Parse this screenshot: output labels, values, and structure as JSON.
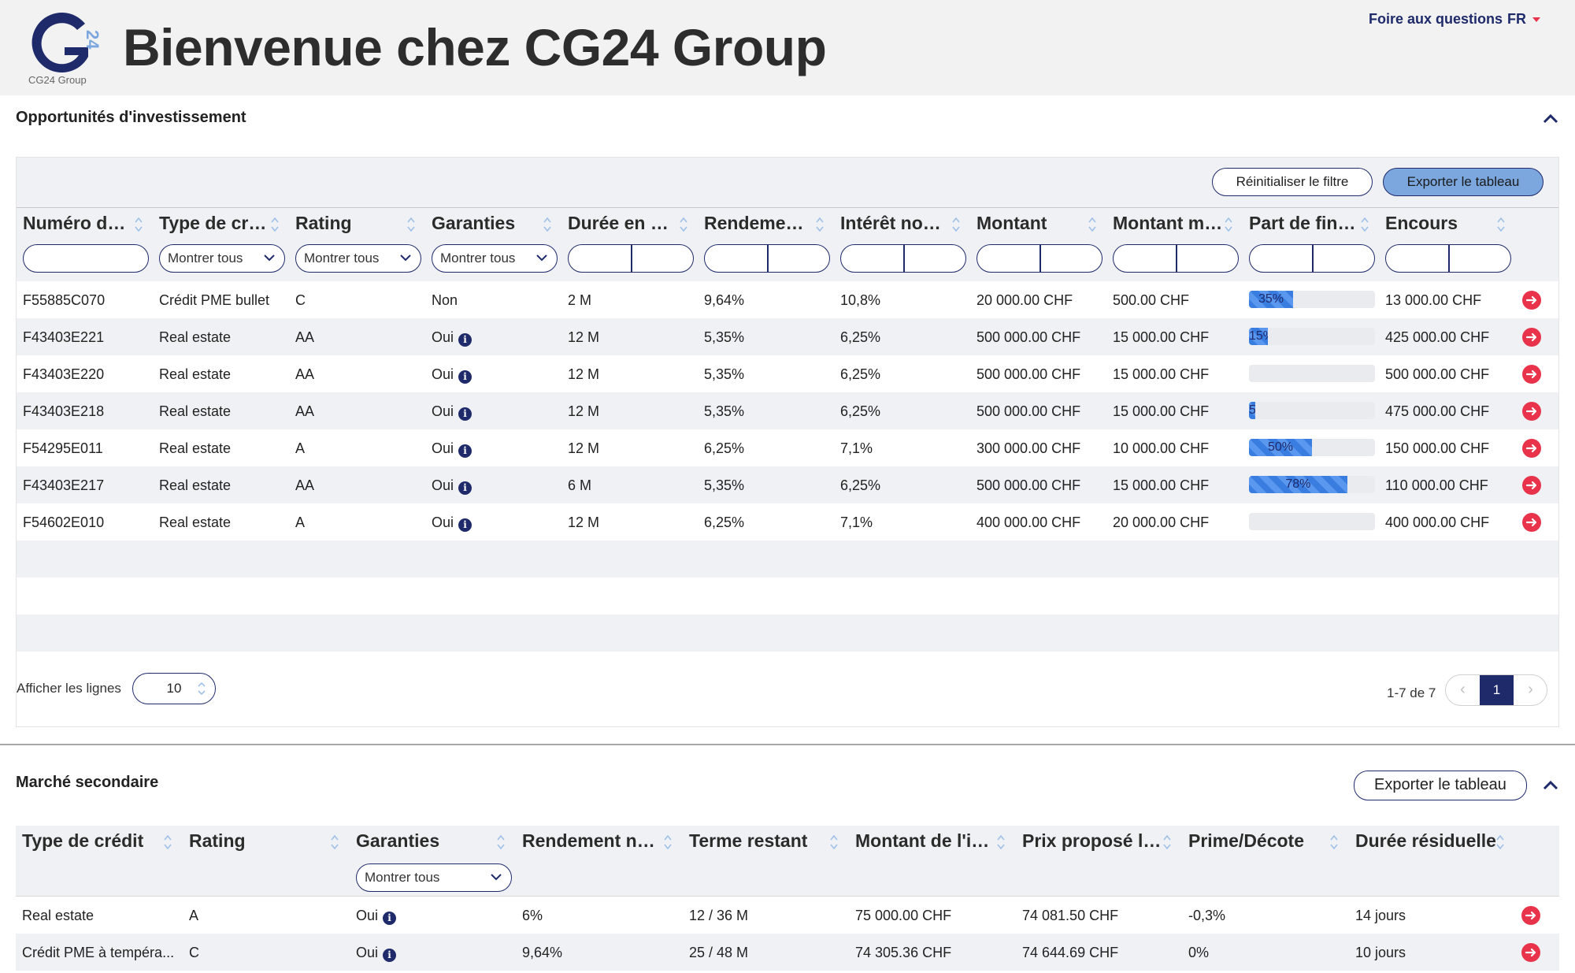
{
  "header": {
    "logo_text": "CG24 Group",
    "title": "Bienvenue chez CG24 Group",
    "faq_label": "Foire aux questions",
    "language": "FR"
  },
  "colors": {
    "brand_navy": "#1f2a6b",
    "brand_blue": "#7ba7de",
    "accent_red": "#e8334a",
    "progress_blue": "#3a7de0"
  },
  "opportunities": {
    "section_title": "Opportunités d'investissement",
    "reset_filter_label": "Réinitialiser le filtre",
    "export_label": "Exporter le tableau",
    "columns": [
      "Numéro de ...",
      "Type de cré...",
      "Rating",
      "Garanties",
      "Durée en m...",
      "Rendement...",
      "Intérêt nom...",
      "Montant",
      "Montant mi...",
      "Part de fina...",
      "Encours"
    ],
    "filters": {
      "type_select": "Montrer tous",
      "rating_select": "Montrer tous",
      "garanties_select": "Montrer tous"
    },
    "rows": [
      {
        "numero": "F55885C070",
        "type": "Crédit PME bullet",
        "rating": "C",
        "garanties": "Non",
        "duree": "2 M",
        "rendement": "9,64%",
        "interet": "10,8%",
        "montant": "20 000.00 CHF",
        "montant_min": "500.00 CHF",
        "part_label": "35%",
        "part_value": 35,
        "encours": "13 000.00 CHF"
      },
      {
        "numero": "F43403E221",
        "type": "Real estate",
        "rating": "AA",
        "garanties": "Oui",
        "duree": "12 M",
        "rendement": "5,35%",
        "interet": "6,25%",
        "montant": "500 000.00 CHF",
        "montant_min": "15 000.00 CHF",
        "part_label": "15%",
        "part_value": 15,
        "encours": "425 000.00 CHF"
      },
      {
        "numero": "F43403E220",
        "type": "Real estate",
        "rating": "AA",
        "garanties": "Oui",
        "duree": "12 M",
        "rendement": "5,35%",
        "interet": "6,25%",
        "montant": "500 000.00 CHF",
        "montant_min": "15 000.00 CHF",
        "part_label": "",
        "part_value": 0,
        "encours": "500 000.00 CHF"
      },
      {
        "numero": "F43403E218",
        "type": "Real estate",
        "rating": "AA",
        "garanties": "Oui",
        "duree": "12 M",
        "rendement": "5,35%",
        "interet": "6,25%",
        "montant": "500 000.00 CHF",
        "montant_min": "15 000.00 CHF",
        "part_label": "5%",
        "part_value": 5,
        "encours": "475 000.00 CHF"
      },
      {
        "numero": "F54295E011",
        "type": "Real estate",
        "rating": "A",
        "garanties": "Oui",
        "duree": "12 M",
        "rendement": "6,25%",
        "interet": "7,1%",
        "montant": "300 000.00 CHF",
        "montant_min": "10 000.00 CHF",
        "part_label": "50%",
        "part_value": 50,
        "encours": "150 000.00 CHF"
      },
      {
        "numero": "F43403E217",
        "type": "Real estate",
        "rating": "AA",
        "garanties": "Oui",
        "duree": "6 M",
        "rendement": "5,35%",
        "interet": "6,25%",
        "montant": "500 000.00 CHF",
        "montant_min": "15 000.00 CHF",
        "part_label": "78%",
        "part_value": 78,
        "encours": "110 000.00 CHF"
      },
      {
        "numero": "F54602E010",
        "type": "Real estate",
        "rating": "A",
        "garanties": "Oui",
        "duree": "12 M",
        "rendement": "6,25%",
        "interet": "7,1%",
        "montant": "400 000.00 CHF",
        "montant_min": "20 000.00 CHF",
        "part_label": "",
        "part_value": 0,
        "encours": "400 000.00 CHF"
      }
    ],
    "rows_label": "Afficher les lignes",
    "rows_per_page": "10",
    "pagination_info": "1-7 de 7",
    "current_page": "1",
    "prev_glyph": "‹",
    "next_glyph": "›"
  },
  "secondary": {
    "section_title": "Marché secondaire",
    "export_label": "Exporter le tableau",
    "columns": [
      "Type de crédit",
      "Rating",
      "Garanties",
      "Rendement net...",
      "Terme restant",
      "Montant de l'in...",
      "Prix proposé l'i...",
      "Prime/Décote",
      "Durée résiduelle"
    ],
    "garanties_select": "Montrer tous",
    "rows": [
      {
        "type": "Real estate",
        "rating": "A",
        "garanties": "Oui",
        "rendement": "6%",
        "terme": "12 / 36 M",
        "montant": "75 000.00 CHF",
        "prix": "74 081.50 CHF",
        "prime": "-0,3%",
        "duree": "14 jours"
      },
      {
        "type": "Crédit PME à tempéra...",
        "rating": "C",
        "garanties": "Oui",
        "rendement": "9,64%",
        "terme": "25 / 48 M",
        "montant": "74 305.36 CHF",
        "prix": "74 644.69 CHF",
        "prime": "0%",
        "duree": "10 jours"
      }
    ]
  }
}
